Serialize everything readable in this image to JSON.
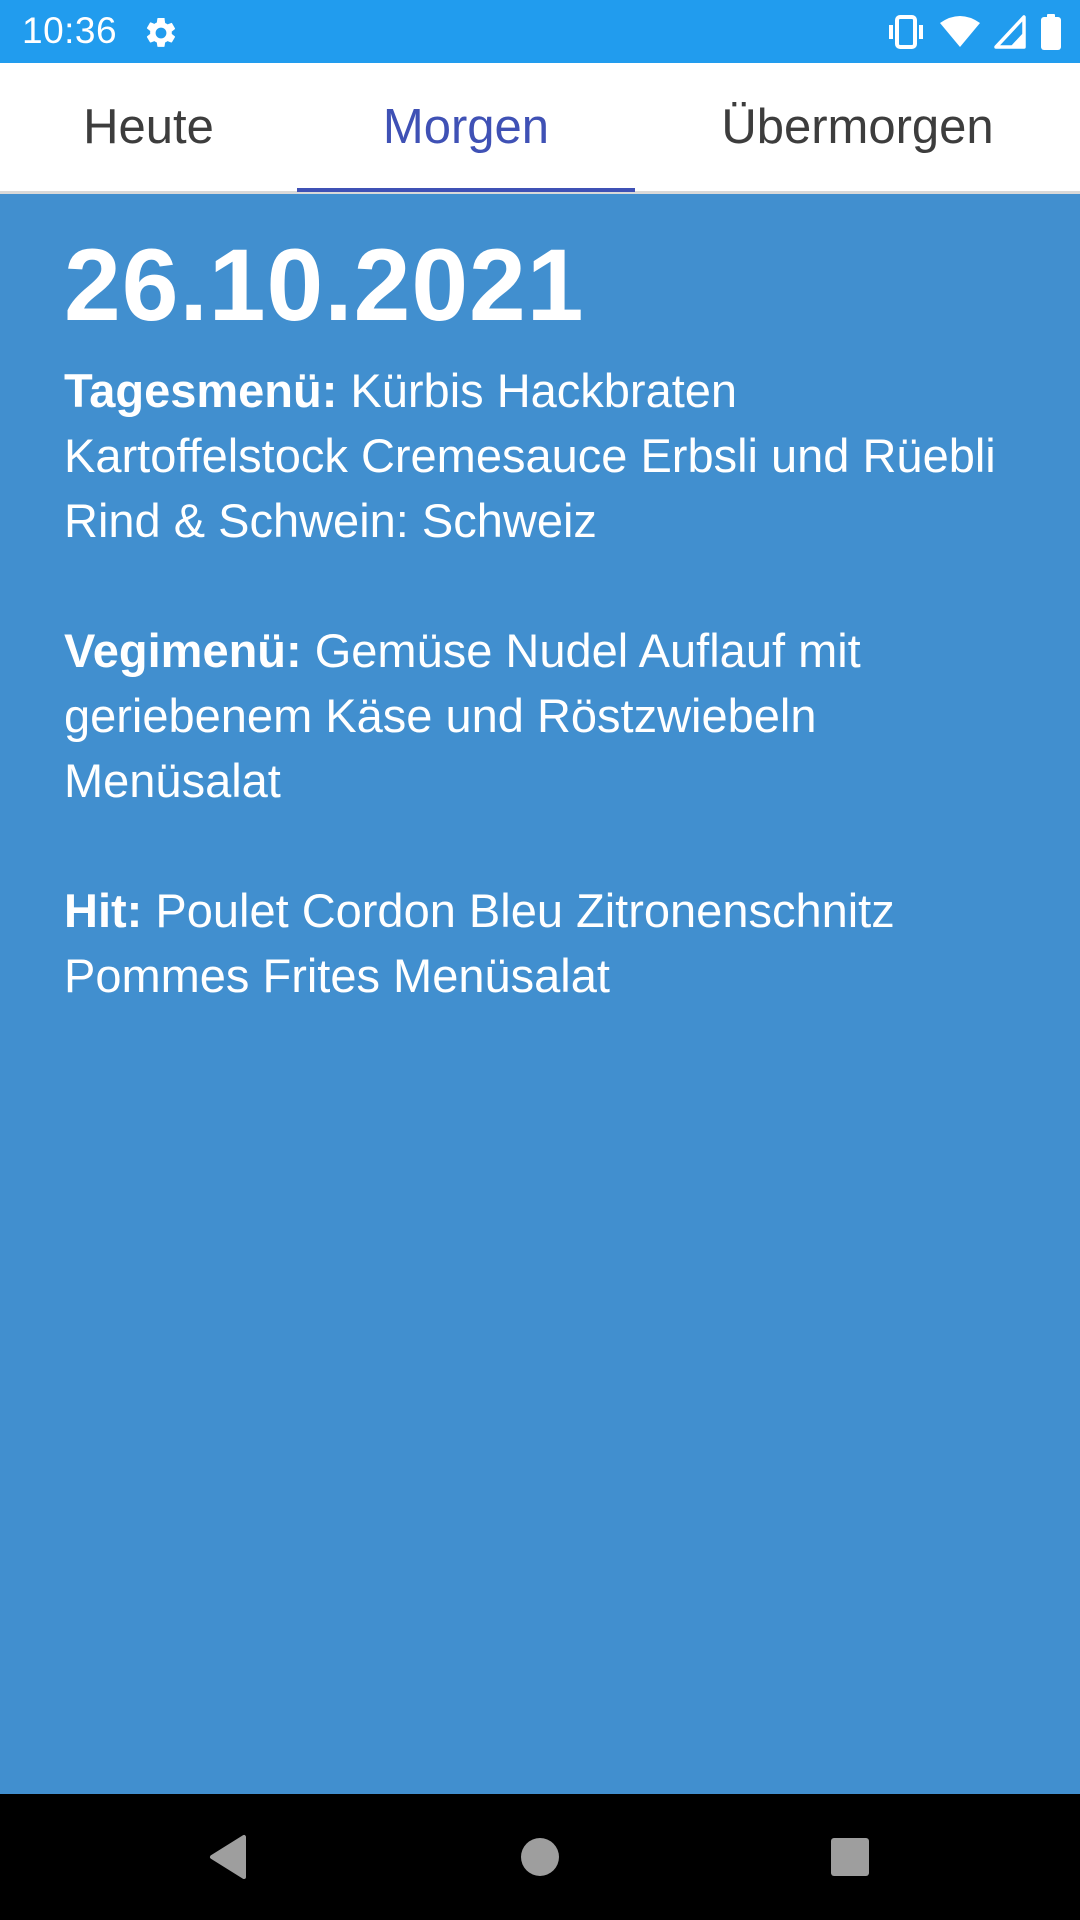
{
  "status_bar": {
    "time": "10:36",
    "icons": [
      "settings-icon",
      "vibrate-icon",
      "wifi-icon",
      "signal-icon",
      "battery-icon"
    ],
    "background_color": "#219cee"
  },
  "tabs": [
    {
      "label": "Heute",
      "selected": false
    },
    {
      "label": "Morgen",
      "selected": true
    },
    {
      "label": "Übermorgen",
      "selected": false
    }
  ],
  "accent_color": "#3f51b5",
  "content": {
    "background_color": "#418fcf",
    "date": "26.10.2021",
    "menus": [
      {
        "label": "Tagesmenü:",
        "text": "Kürbis Hackbraten Kartoffelstock Cremesauce Erbsli und Rüebli Rind & Schwein: Schweiz"
      },
      {
        "label": "Vegimenü:",
        "text": "Gemüse Nudel Auflauf mit geriebenem Käse und Röstzwiebeln Menüsalat"
      },
      {
        "label": "Hit:",
        "text": "Poulet Cordon Bleu Zitronenschnitz Pommes Frites Menüsalat"
      }
    ]
  },
  "nav_bar": {
    "buttons": [
      "back-icon",
      "home-icon",
      "recents-icon"
    ]
  }
}
